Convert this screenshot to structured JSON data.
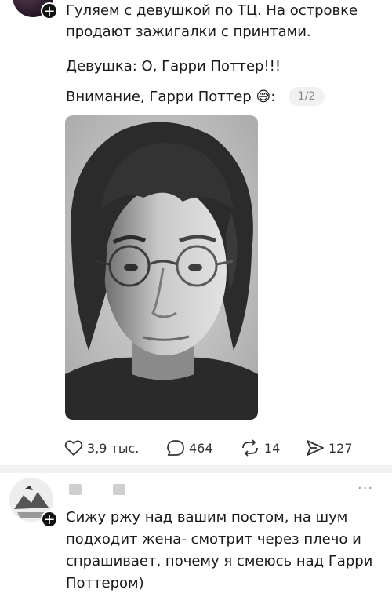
{
  "post": {
    "lines": [
      "Гуляем с девушкой по ТЦ. На островке",
      "продают зажигалки с принтами."
    ],
    "quote1": "Девушка: О, Гарри Поттер!!!",
    "quote2": "Внимание, Гарри Поттер",
    "emoji": "😅",
    "colon": ":",
    "pager": "1/2",
    "photo_description": "black-and-white portrait of a man with round glasses"
  },
  "actions": {
    "likes": "3,9 тыс.",
    "comments": "464",
    "reposts": "14",
    "shares": "127"
  },
  "comment": {
    "more": "···",
    "lines": [
      "Сижу ржу над вашим постом, на шум",
      "подходит жена- смотрит через плечо и",
      "спрашивает, почему я смеюсь над Гарри",
      "Поттером)"
    ]
  },
  "icons": [
    "plus-icon",
    "heart-icon",
    "comment-icon",
    "repost-icon",
    "share-icon",
    "more-icon"
  ]
}
